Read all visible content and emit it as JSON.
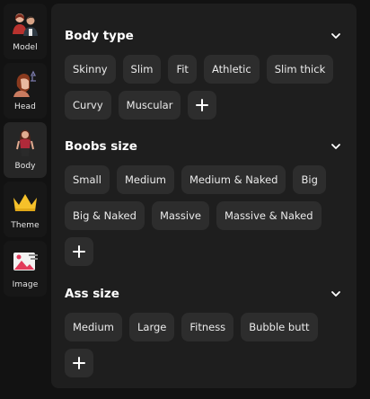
{
  "sidebar": {
    "items": [
      {
        "label": "Model",
        "icon": "model-avatars-icon",
        "active": false
      },
      {
        "label": "Head",
        "icon": "head-profile-icon",
        "active": false
      },
      {
        "label": "Body",
        "icon": "body-figure-icon",
        "active": true
      },
      {
        "label": "Theme",
        "icon": "crown-icon",
        "active": false
      },
      {
        "label": "Image",
        "icon": "image-icon",
        "active": false
      }
    ]
  },
  "sections": [
    {
      "title": "Body type",
      "options": [
        "Skinny",
        "Slim",
        "Fit",
        "Athletic",
        "Slim thick",
        "Curvy",
        "Muscular"
      ]
    },
    {
      "title": "Boobs size",
      "options": [
        "Small",
        "Medium",
        "Medium & Naked",
        "Big",
        "Big & Naked",
        "Massive",
        "Massive & Naked"
      ]
    },
    {
      "title": "Ass size",
      "options": [
        "Medium",
        "Large",
        "Fitness",
        "Bubble butt"
      ]
    }
  ],
  "colors": {
    "background": "#121212",
    "panel": "#1e1e1e",
    "chip": "#2d2d2d",
    "sidebar_active": "#262626",
    "crown": "#f6c12a"
  }
}
